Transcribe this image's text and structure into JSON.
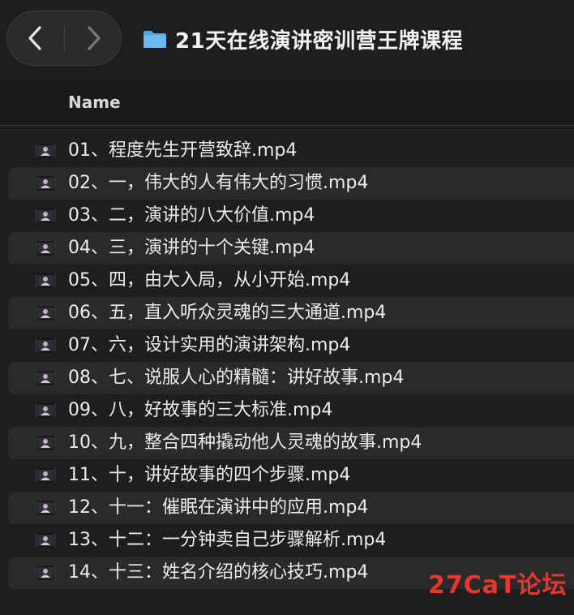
{
  "window": {
    "title": "21天在线演讲密训营王牌课程",
    "folder_icon": "folder-icon",
    "folder_color": "#6cb7ee"
  },
  "nav": {
    "back_icon": "chevron-left-icon",
    "forward_icon": "chevron-right-icon"
  },
  "list_header": {
    "name_label": "Name"
  },
  "files": [
    {
      "name": "01、程度先生开营致辞.mp4"
    },
    {
      "name": "02、一，伟大的人有伟大的习惯.mp4"
    },
    {
      "name": "03、二，演讲的八大价值.mp4"
    },
    {
      "name": "04、三，演讲的十个关键.mp4"
    },
    {
      "name": "05、四，由大入局，从小开始.mp4"
    },
    {
      "name": "06、五，直入听众灵魂的三大通道.mp4"
    },
    {
      "name": "07、六，设计实用的演讲架构.mp4"
    },
    {
      "name": "08、七、说服人心的精髓：讲好故事.mp4"
    },
    {
      "name": "09、八，好故事的三大标准.mp4"
    },
    {
      "name": "10、九，整合四种撬动他人灵魂的故事.mp4"
    },
    {
      "name": "11、十，讲好故事的四个步骤.mp4"
    },
    {
      "name": "12、十一：催眠在演讲中的应用.mp4"
    },
    {
      "name": "13、十二：一分钟卖自己步骤解析.mp4"
    },
    {
      "name": "14、十三：姓名介绍的核心技巧.mp4"
    }
  ],
  "watermark": {
    "text": "27CaT论坛",
    "color": "#e8352e"
  }
}
